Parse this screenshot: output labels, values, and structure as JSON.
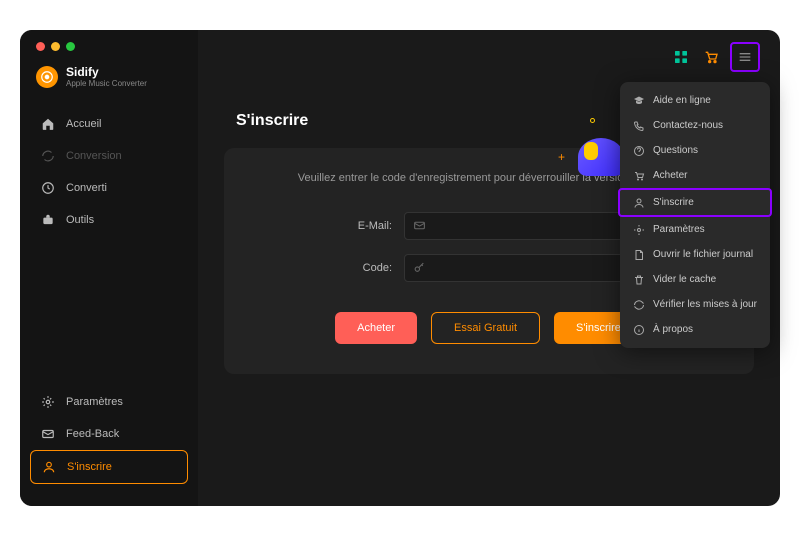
{
  "brand": {
    "name": "Sidify",
    "sub": "Apple Music Converter"
  },
  "nav": {
    "accueil": "Accueil",
    "conversion": "Conversion",
    "converti": "Converti",
    "outils": "Outils"
  },
  "bottom": {
    "parametres": "Paramètres",
    "feedback": "Feed-Back",
    "sinscrire": "S'inscrire"
  },
  "page": {
    "title": "S'inscrire",
    "prompt": "Veuillez entrer le code d'enregistrement pour déverrouiller la version complète.",
    "emailLabel": "E-Mail:",
    "codeLabel": "Code:",
    "btnBuy": "Acheter",
    "btnTrial": "Essai Gratuit",
    "btnRegister": "S'inscrire"
  },
  "menu": {
    "aide": "Aide en ligne",
    "contact": "Contactez-nous",
    "questions": "Questions",
    "acheter": "Acheter",
    "sinscrire": "S'inscrire",
    "parametres": "Paramètres",
    "journal": "Ouvrir le fichier journal",
    "cache": "Vider le cache",
    "maj": "Vérifier les mises à jour",
    "apropos": "À propos"
  }
}
